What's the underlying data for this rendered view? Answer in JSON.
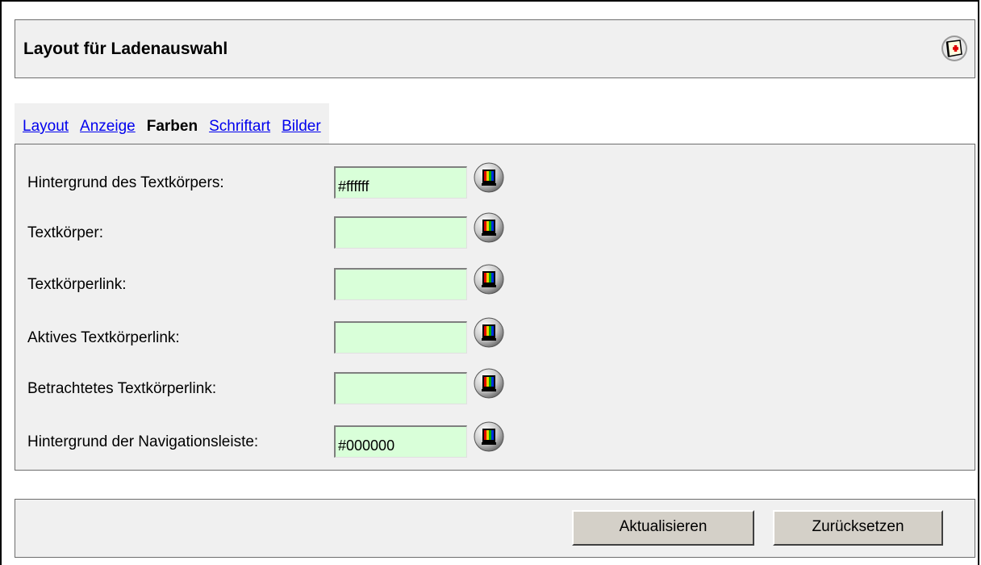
{
  "header": {
    "title": "Layout für Ladenauswahl",
    "help_icon": "help-book-icon"
  },
  "tabs": [
    {
      "label": "Layout",
      "active": false
    },
    {
      "label": "Anzeige",
      "active": false
    },
    {
      "label": "Farben",
      "active": true
    },
    {
      "label": "Schriftart",
      "active": false
    },
    {
      "label": "Bilder",
      "active": false
    }
  ],
  "fields": [
    {
      "label": "Hintergrund des Textkörpers:",
      "value": "#ffffff"
    },
    {
      "label": "Textkörper:",
      "value": ""
    },
    {
      "label": "Textkörperlink:",
      "value": ""
    },
    {
      "label": "Aktives Textkörperlink:",
      "value": ""
    },
    {
      "label": "Betrachtetes Textkörperlink:",
      "value": ""
    },
    {
      "label": "Hintergrund der Navigationsleiste:",
      "value": "#000000"
    }
  ],
  "picker_icon": "color-picker-icon",
  "buttons": {
    "update": "Aktualisieren",
    "reset": "Zurücksetzen"
  },
  "colors": {
    "field_bg": "#d9ffd9",
    "panel_bg": "#f0f0f0",
    "link": "#0000ee"
  }
}
